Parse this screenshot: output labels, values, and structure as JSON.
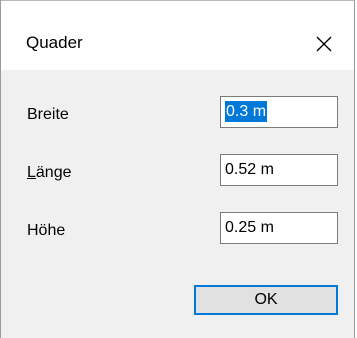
{
  "window": {
    "title": "Quader",
    "close_icon": "close-icon"
  },
  "fields": [
    {
      "label_mnemonic": "",
      "label_rest": "Breite",
      "value": "0.3 m"
    },
    {
      "label_mnemonic": "L",
      "label_rest": "änge",
      "value": "0.52 m"
    },
    {
      "label_mnemonic": "",
      "label_rest": "Höhe",
      "value": "0.25 m"
    }
  ],
  "buttons": {
    "ok_label": "OK"
  },
  "colors": {
    "accent": "#0078d7",
    "dialog_bg": "#f0f0f0",
    "titlebar_bg": "#ffffff"
  }
}
